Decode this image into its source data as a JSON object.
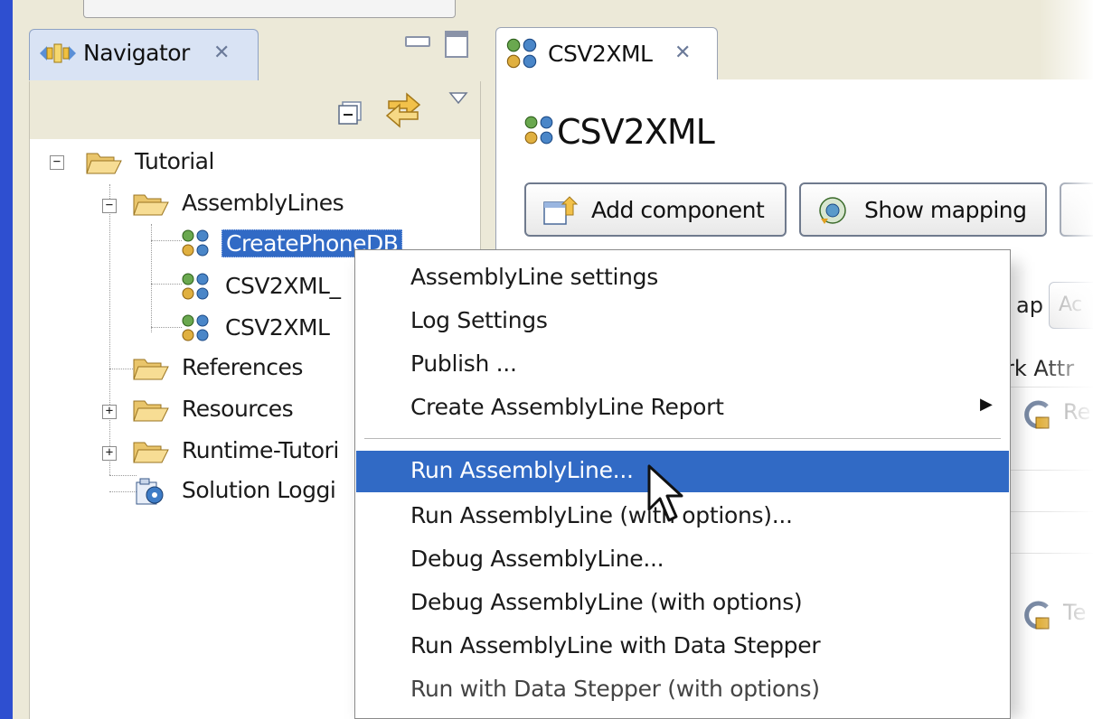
{
  "navigator": {
    "tab_label": "Navigator",
    "close_glyph": "✕",
    "icons": [
      "navigator-view-icon",
      "minimize-icon",
      "maximize-icon",
      "collapse-all-icon",
      "link-with-editor-icon",
      "view-menu-icon"
    ],
    "tree": {
      "root": "Tutorial",
      "assembly_lines_folder": "AssemblyLines",
      "assembly_lines": [
        "CreatePhoneDB",
        "CSV2XML_",
        "CSV2XML"
      ],
      "references": "References",
      "resources": "Resources",
      "runtime": "Runtime-Tutori",
      "solution_logging": "Solution Loggi"
    },
    "expander_minus": "−",
    "expander_plus": "+"
  },
  "editor": {
    "tab_label": "CSV2XML",
    "close_glyph": "✕",
    "title": "CSV2XML",
    "add_component_label": "Add component",
    "show_mapping_label": "Show mapping",
    "partial_ap": "ap",
    "partial_ac": "Ac",
    "partial_work_attr": "rk Attr",
    "partial_re": "Re",
    "partial_te": "Te"
  },
  "context_menu": {
    "items": [
      "AssemblyLine settings",
      "Log Settings",
      "Publish ...",
      "Create AssemblyLine Report",
      "Run AssemblyLine...",
      "Run AssemblyLine (with options)...",
      "Debug AssemblyLine...",
      "Debug AssemblyLine (with options)",
      "Run AssemblyLine with Data Stepper",
      "Run with Data Stepper (with options)"
    ],
    "highlighted_item": "Run AssemblyLine...",
    "submenu_arrow": "▶"
  },
  "colors": {
    "selection_blue": "#316ac5",
    "window_edge_blue": "#2e4fd0",
    "panel_bg": "#ece9d8"
  }
}
